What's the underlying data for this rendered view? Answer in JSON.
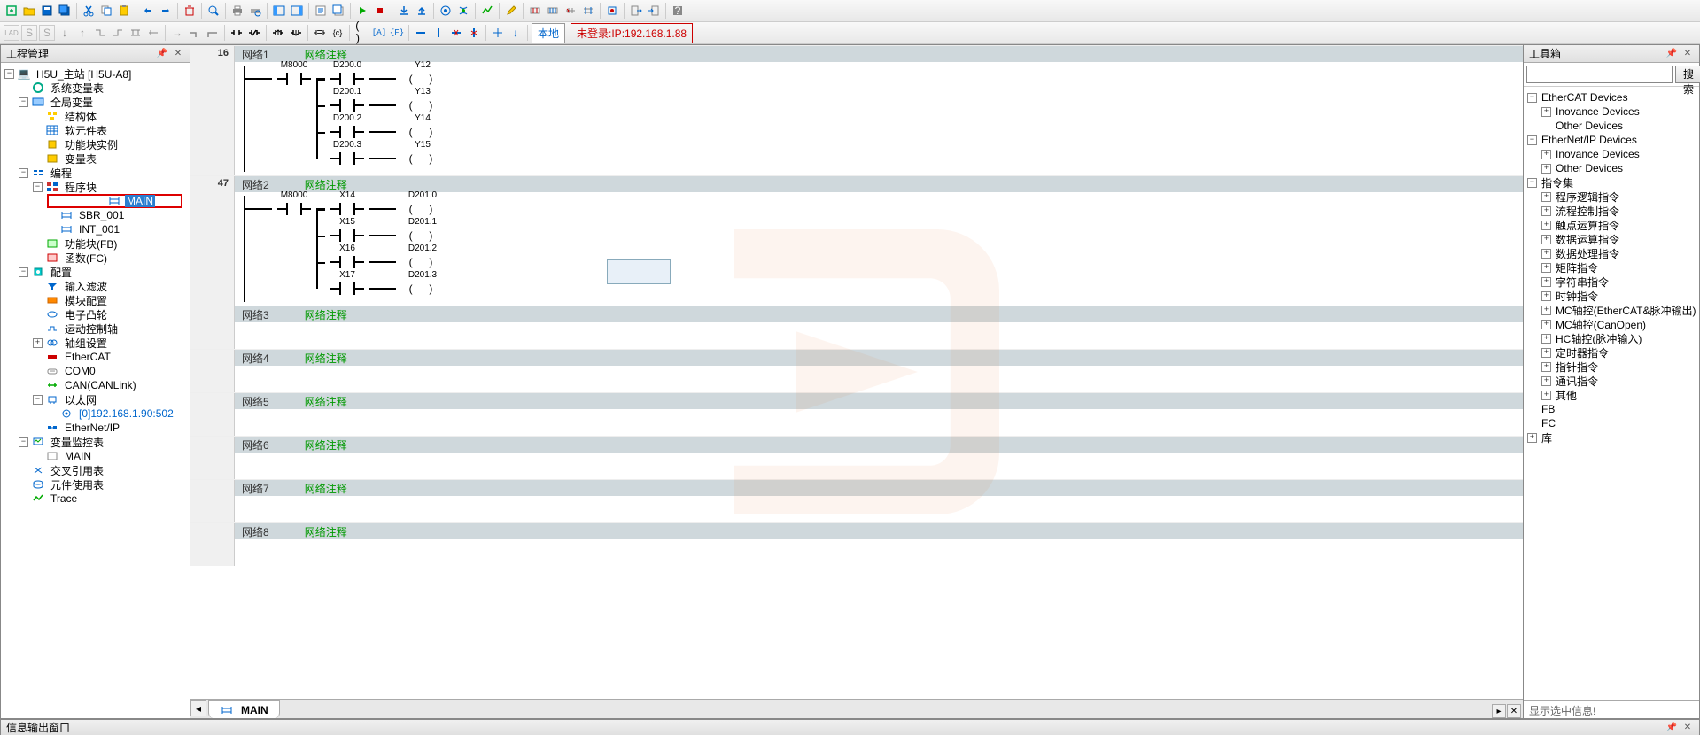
{
  "toolbar1": {
    "local_btn": "本地",
    "status": "未登录:IP:192.168.1.88"
  },
  "left_panel": {
    "title": "工程管理",
    "root": {
      "label": "H5U_主站 [H5U-A8]"
    },
    "sysvar": "系统变量表",
    "globalvar": "全局变量",
    "struct": "结构体",
    "softcomp": "软元件表",
    "fbinst": "功能块实例",
    "vartable": "变量表",
    "program": "编程",
    "progblk": "程序块",
    "main": "MAIN",
    "sbr": "SBR_001",
    "int": "INT_001",
    "fb": "功能块(FB)",
    "fc": "函数(FC)",
    "config": "配置",
    "input_filter": "输入滤波",
    "module_cfg": "模块配置",
    "ecam": "电子凸轮",
    "motion_axis": "运动控制轴",
    "axis_set": "轴组设置",
    "ethercat": "EtherCAT",
    "com0": "COM0",
    "can": "CAN(CANLink)",
    "ethernet": "以太网",
    "eth_item": "[0]192.168.1.90:502",
    "enetip": "EtherNet/IP",
    "varmon": "变量监控表",
    "mon_main": "MAIN",
    "xref": "交叉引用表",
    "usage": "元件使用表",
    "trace": "Trace"
  },
  "networks": [
    {
      "num": "16",
      "id": "网络1",
      "comment": "网络注释",
      "rungs": [
        {
          "left": "M8000",
          "mid": "D200.0",
          "coil": "Y12"
        },
        {
          "left": "",
          "mid": "D200.1",
          "coil": "Y13"
        },
        {
          "left": "",
          "mid": "D200.2",
          "coil": "Y14"
        },
        {
          "left": "",
          "mid": "D200.3",
          "coil": "Y15"
        }
      ]
    },
    {
      "num": "47",
      "id": "网络2",
      "comment": "网络注释",
      "rungs": [
        {
          "left": "M8000",
          "mid": "X14",
          "coil": "D201.0"
        },
        {
          "left": "",
          "mid": "X15",
          "coil": "D201.1"
        },
        {
          "left": "",
          "mid": "X16",
          "coil": "D201.2"
        },
        {
          "left": "",
          "mid": "X17",
          "coil": "D201.3"
        }
      ]
    },
    {
      "num": "",
      "id": "网络3",
      "comment": "网络注释",
      "rungs": []
    },
    {
      "num": "",
      "id": "网络4",
      "comment": "网络注释",
      "rungs": []
    },
    {
      "num": "",
      "id": "网络5",
      "comment": "网络注释",
      "rungs": []
    },
    {
      "num": "",
      "id": "网络6",
      "comment": "网络注释",
      "rungs": []
    },
    {
      "num": "",
      "id": "网络7",
      "comment": "网络注释",
      "rungs": []
    },
    {
      "num": "",
      "id": "网络8",
      "comment": "网络注释",
      "rungs": []
    }
  ],
  "tab": {
    "name": "MAIN"
  },
  "right_panel": {
    "title": "工具箱",
    "search_btn": "搜索",
    "tree": {
      "ecat": "EtherCAT Devices",
      "ecat_inov": "Inovance Devices",
      "ecat_other": "Other Devices",
      "enip": "EtherNet/IP Devices",
      "enip_inov": "Inovance Devices",
      "enip_other": "Other Devices",
      "instr": "指令集",
      "i1": "程序逻辑指令",
      "i2": "流程控制指令",
      "i3": "触点运算指令",
      "i4": "数据运算指令",
      "i5": "数据处理指令",
      "i6": "矩阵指令",
      "i7": "字符串指令",
      "i8": "时钟指令",
      "i9": "MC轴控(EtherCAT&脉冲输出)",
      "i10": "MC轴控(CanOpen)",
      "i11": "HC轴控(脉冲输入)",
      "i12": "定时器指令",
      "i13": "指针指令",
      "i14": "通讯指令",
      "i15": "其他",
      "fb": "FB",
      "fc": "FC",
      "lib": "库"
    },
    "footer": "显示选中信息!"
  },
  "bottom_panel": {
    "title": "信息输出窗口"
  }
}
